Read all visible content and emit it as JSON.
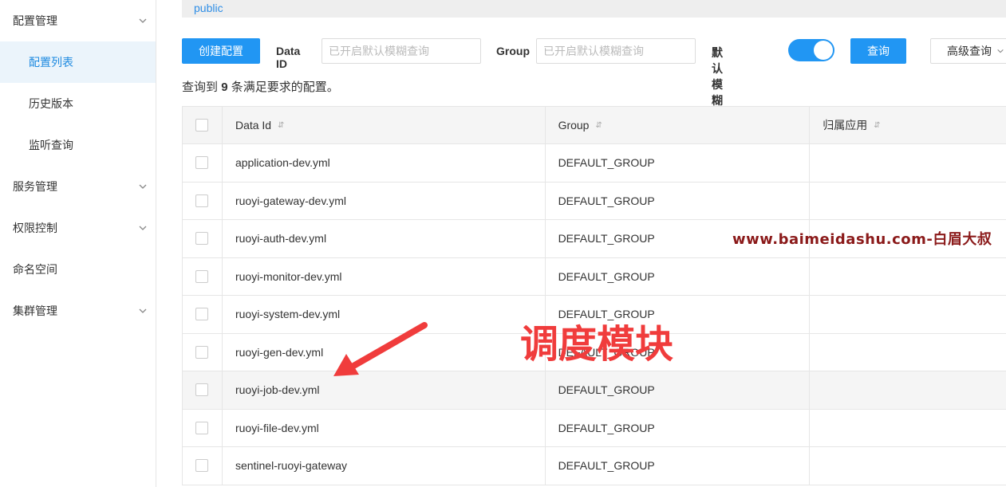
{
  "sidebar": {
    "items": [
      {
        "label": "配置管理",
        "type": "group",
        "chevron": true
      },
      {
        "label": "配置列表",
        "type": "sub",
        "active": true
      },
      {
        "label": "历史版本",
        "type": "sub"
      },
      {
        "label": "监听查询",
        "type": "sub"
      },
      {
        "label": "服务管理",
        "type": "group",
        "chevron": true
      },
      {
        "label": "权限控制",
        "type": "group",
        "chevron": true
      },
      {
        "label": "命名空间",
        "type": "group"
      },
      {
        "label": "集群管理",
        "type": "group",
        "chevron": true
      }
    ]
  },
  "namespace": {
    "label": "public"
  },
  "toolbar": {
    "create_label": "创建配置",
    "dataid_label": "Data ID",
    "dataid_placeholder": "已开启默认模糊查询",
    "group_label": "Group",
    "group_placeholder": "已开启默认模糊查询",
    "fuzzy_label": "默认模糊匹配",
    "fuzzy_enabled": true,
    "query_label": "查询",
    "advanced_label": "高级查询"
  },
  "result": {
    "prefix": "查询到",
    "count": "9",
    "suffix": "条满足要求的配置。"
  },
  "table": {
    "headers": {
      "dataid": "Data Id",
      "group": "Group",
      "app": "归属应用"
    },
    "rows": [
      {
        "dataid": "application-dev.yml",
        "group": "DEFAULT_GROUP"
      },
      {
        "dataid": "ruoyi-gateway-dev.yml",
        "group": "DEFAULT_GROUP"
      },
      {
        "dataid": "ruoyi-auth-dev.yml",
        "group": "DEFAULT_GROUP"
      },
      {
        "dataid": "ruoyi-monitor-dev.yml",
        "group": "DEFAULT_GROUP"
      },
      {
        "dataid": "ruoyi-system-dev.yml",
        "group": "DEFAULT_GROUP"
      },
      {
        "dataid": "ruoyi-gen-dev.yml",
        "group": "DEFAULT_GROUP"
      },
      {
        "dataid": "ruoyi-job-dev.yml",
        "group": "DEFAULT_GROUP"
      },
      {
        "dataid": "ruoyi-file-dev.yml",
        "group": "DEFAULT_GROUP"
      },
      {
        "dataid": "sentinel-ruoyi-gateway",
        "group": "DEFAULT_GROUP"
      }
    ]
  },
  "annotations": {
    "watermark": "www.baimeidashu.com-白眉大叔",
    "highlight": "调度模块"
  },
  "colors": {
    "primary": "#2196f3",
    "active_bg": "#ebf4fb",
    "annotation_red": "#f03c3c",
    "watermark": "#8b1a1a"
  }
}
